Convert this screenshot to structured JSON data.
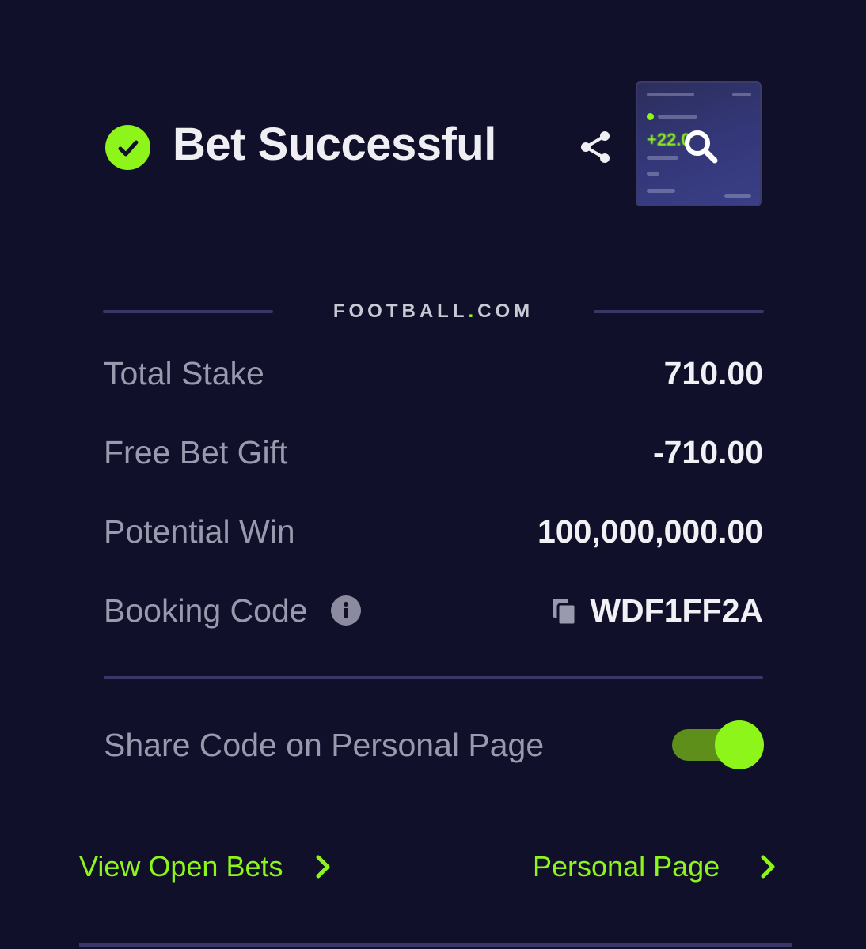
{
  "header": {
    "title": "Bet Successful",
    "status_icon": "check-circle-icon",
    "share_icon": "share-icon"
  },
  "thumbnail": {
    "amount_preview": "+22.0",
    "overlay_icon": "magnify-icon"
  },
  "brand": {
    "name_part1": "FOOTBALL",
    "dot": ".",
    "name_part2": "COM"
  },
  "summary": {
    "rows": [
      {
        "label": "Total Stake",
        "value": "710.00"
      },
      {
        "label": "Free Bet Gift",
        "value": "-710.00"
      },
      {
        "label": "Potential Win",
        "value": "100,000,000.00"
      },
      {
        "label": "Booking Code",
        "value": "WDF1FF2A"
      }
    ]
  },
  "toggle": {
    "label": "Share Code on Personal Page",
    "enabled": true
  },
  "links": {
    "view_open_bets": "View Open Bets",
    "personal_page": "Personal Page"
  },
  "colors": {
    "background": "#11102a",
    "accent": "#8ef51b",
    "divider": "#3a3768",
    "label": "#9a9aae",
    "value": "#f1f1f5"
  }
}
